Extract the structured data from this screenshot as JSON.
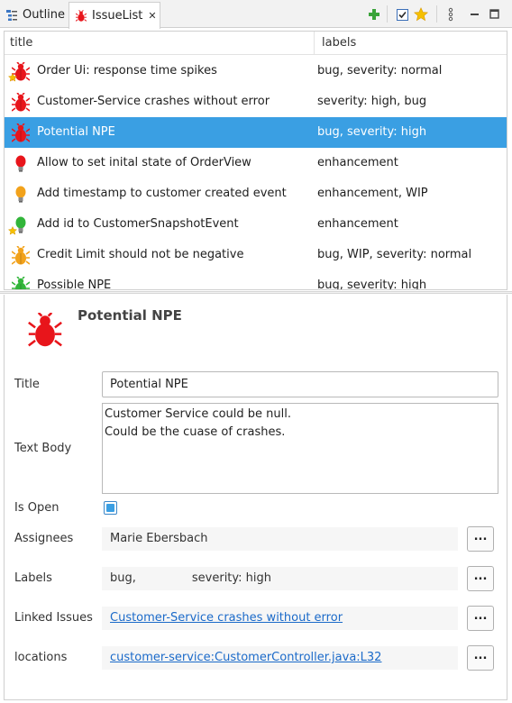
{
  "tabs": [
    {
      "label": "Outline",
      "icon": "outline-icon"
    },
    {
      "label": "IssueList",
      "icon": "bug-icon",
      "close": "✕"
    }
  ],
  "toolbar": {
    "add_icon": "add-icon",
    "check_icon": "checkbox-icon",
    "star_icon": "star-icon",
    "menu_icon": "view-menu-icon",
    "minimize_icon": "minimize-icon",
    "maximize_icon": "maximize-icon"
  },
  "table": {
    "columns": [
      "title",
      "labels"
    ],
    "rows": [
      {
        "title": "Order Ui: response time spikes",
        "labels": "bug, severity: normal",
        "icon": "bug-icon",
        "color": "#e8151b",
        "starred": true,
        "selected": false
      },
      {
        "title": "Customer-Service crashes without error",
        "labels": "severity: high, bug",
        "icon": "bug-icon",
        "color": "#e8151b",
        "starred": false,
        "selected": false
      },
      {
        "title": "Potential NPE",
        "labels": "bug, severity: high",
        "icon": "bug-icon",
        "color": "#e8151b",
        "starred": false,
        "selected": true
      },
      {
        "title": "Allow to set inital state of OrderView",
        "labels": "enhancement",
        "icon": "lightbulb-icon",
        "color": "#e8151b",
        "starred": false,
        "selected": false
      },
      {
        "title": "Add timestamp to customer created event",
        "labels": "enhancement, WIP",
        "icon": "lightbulb-icon",
        "color": "#f2a21b",
        "starred": false,
        "selected": false
      },
      {
        "title": "Add id to CustomerSnapshotEvent",
        "labels": "enhancement",
        "icon": "lightbulb-icon",
        "color": "#32b53a",
        "starred": true,
        "selected": false
      },
      {
        "title": "Credit Limit should not be negative",
        "labels": "bug, WIP, severity: normal",
        "icon": "bug-icon",
        "color": "#f2a21b",
        "starred": false,
        "selected": false
      },
      {
        "title": "Possible NPE",
        "labels": "bug, severity: high",
        "icon": "bug-icon",
        "color": "#32b53a",
        "starred": false,
        "selected": false
      }
    ]
  },
  "detail": {
    "heading": "Potential NPE",
    "icon": "bug-icon",
    "icon_color": "#e8151b",
    "title_label": "Title",
    "title_value": "Potential NPE",
    "body_label": "Text Body",
    "body_value": "Customer Service could be null.\nCould be the cuase of crashes.",
    "open_label": "Is Open",
    "is_open": true,
    "assignees_label": "Assignees",
    "assignees_value": "Marie Ebersbach",
    "labels_label": "Labels",
    "labels_values": [
      "bug,",
      "severity: high"
    ],
    "linked_label": "Linked Issues",
    "linked_value": "Customer-Service crashes without error",
    "locations_label": "locations",
    "locations_value": "customer-service:CustomerController.java:L32",
    "dots_label": "..."
  }
}
